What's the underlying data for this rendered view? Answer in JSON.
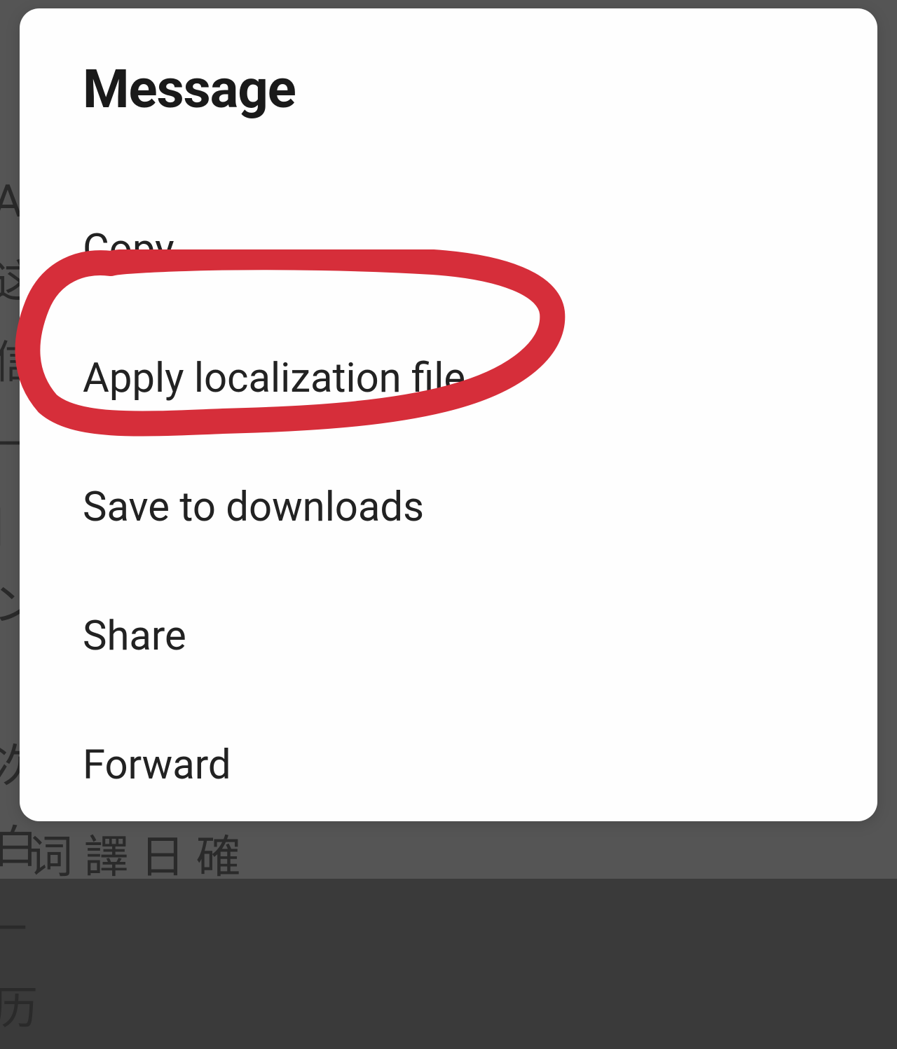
{
  "dialog": {
    "title": "Message",
    "items": [
      "Copy",
      "Apply localization file",
      "Save to downloads",
      "Share",
      "Forward"
    ]
  },
  "annotation": {
    "color": "#d62e3a",
    "highlights_index": 1
  },
  "backdrop": {
    "left_chars": "A\n这\n信\n—\n|\nン\n\n次\n白\n—\n历",
    "bottom_text": "词 譯 日 確"
  }
}
